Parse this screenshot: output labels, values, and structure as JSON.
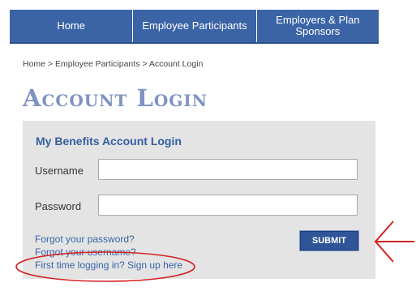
{
  "nav": {
    "items": [
      {
        "label": "Home"
      },
      {
        "label": "Employee Participants"
      },
      {
        "label": "Employers & Plan Sponsors"
      }
    ],
    "background_color": "#3a64a6"
  },
  "breadcrumb": "Home > Employee Participants > Account Login",
  "page_title": "Account Login",
  "login_panel": {
    "title": "My Benefits Account Login",
    "username_label": "Username",
    "username_value": "",
    "password_label": "Password",
    "password_value": "",
    "forgot_password_link": "Forgot your password?",
    "forgot_username_link": "Forgot your username?",
    "signup_link": "First time logging in? Sign up here",
    "submit_label": "SUBMIT"
  },
  "colors": {
    "accent": "#335fa0",
    "title": "#7f93c2",
    "panel_background": "#e4e4e4",
    "annotation": "#d42020"
  },
  "annotations": {
    "arrow_icon": "left-arrow-icon",
    "circle_icon": "highlight-ellipse"
  }
}
